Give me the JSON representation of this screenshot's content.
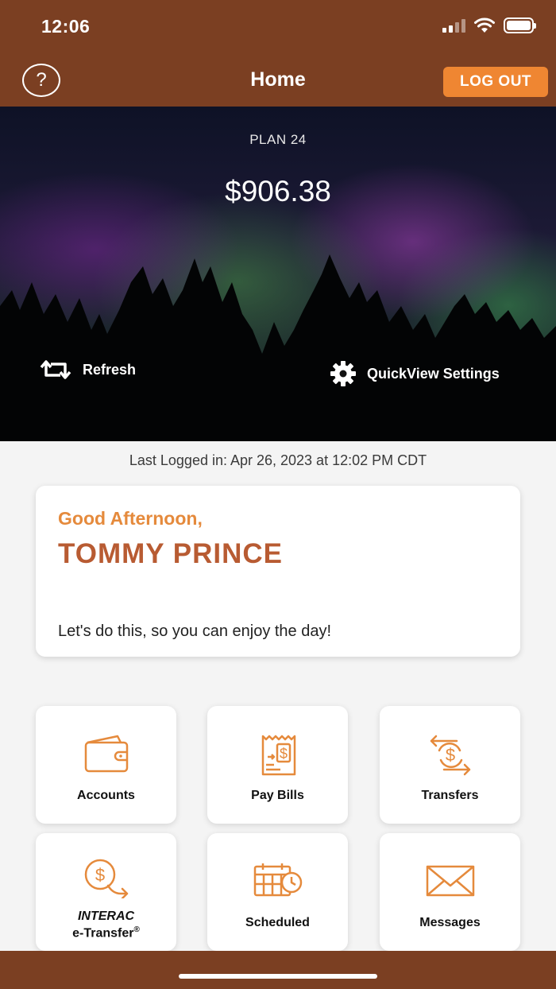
{
  "status_bar": {
    "time": "12:06"
  },
  "header": {
    "title": "Home",
    "help_symbol": "?",
    "logout_label": "LOG OUT"
  },
  "hero": {
    "plan_label": "PLAN 24",
    "balance": "$906.38",
    "refresh_label": "Refresh",
    "quickview_label": "QuickView Settings"
  },
  "last_login": "Last Logged in: Apr 26, 2023 at 12:02 PM  CDT",
  "greeting": {
    "salutation": "Good Afternoon,",
    "name": "TOMMY PRINCE",
    "message": "Let's do this, so you can enjoy the day!"
  },
  "tiles": [
    {
      "label": "Accounts",
      "icon": "wallet-icon"
    },
    {
      "label": "Pay Bills",
      "icon": "bill-icon"
    },
    {
      "label": "Transfers",
      "icon": "transfer-icon"
    },
    {
      "label_line1": "INTERAC",
      "label_line2": "e-Transfer",
      "label_mark": "®",
      "icon": "etransfer-icon"
    },
    {
      "label": "Scheduled",
      "icon": "calendar-clock-icon"
    },
    {
      "label": "Messages",
      "icon": "envelope-icon"
    }
  ],
  "colors": {
    "brown": "#7b3f22",
    "orange": "#ef8632",
    "accent_orange": "#e58a3c",
    "name_rust": "#b85b32"
  }
}
